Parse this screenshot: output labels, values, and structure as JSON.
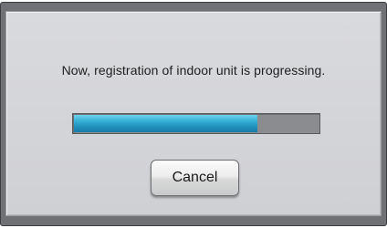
{
  "dialog": {
    "message": "Now, registration of indoor unit is progressing.",
    "progress": {
      "percent": 75,
      "fill_color": "#2ea0c8",
      "track_color": "#8a8c8f"
    },
    "cancel_label": "Cancel"
  }
}
